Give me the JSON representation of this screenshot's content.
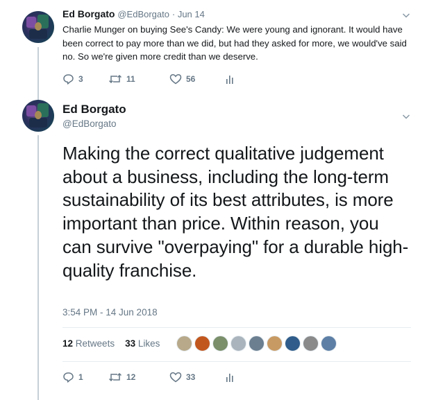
{
  "tweet1": {
    "name": "Ed Borgato",
    "handle": "@EdBorgato",
    "date": "· Jun 14",
    "text": "Charlie Munger on buying See's Candy:  We were young and ignorant. It would have been correct to pay more than we did, but had they asked for more, we would've said no. So we're given more credit than we deserve.",
    "replies": "3",
    "retweets": "11",
    "likes": "56"
  },
  "tweet2": {
    "name": "Ed Borgato",
    "handle": "@EdBorgato",
    "text": "Making the correct qualitative judgement about a business, including the long-term sustainability of its best attributes, is more important than price. Within reason, you can survive \"overpaying\" for a durable high-quality franchise.",
    "timestamp": "3:54 PM - 14 Jun 2018",
    "retweet_count": "12",
    "retweet_label": "Retweets",
    "like_count": "33",
    "like_label": "Likes",
    "replies": "1",
    "retweets": "12",
    "likes": "33",
    "liker_colors": [
      "#b7a98a",
      "#c2571e",
      "#7a8f6a",
      "#aab4bd",
      "#6b7f91",
      "#c89a63",
      "#2f5c8a",
      "#8a8a8a",
      "#5d7fa6"
    ]
  },
  "colors": {
    "secondary_text": "#657786",
    "primary_text": "#14171a",
    "thread_line": "#c4cfd6"
  }
}
